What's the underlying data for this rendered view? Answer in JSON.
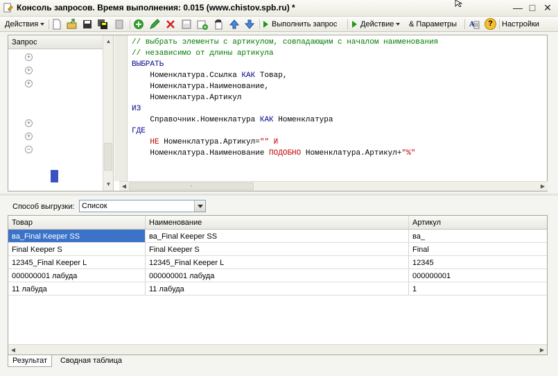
{
  "window": {
    "title": "Консоль запросов. Время выполнения: 0.015 (www.chistov.spb.ru) *",
    "minimize": "—",
    "maximize": "□",
    "close": "✕"
  },
  "toolbar": {
    "actions_label": "Действия",
    "execute_label": "Выполнить запрос",
    "action_label": "Действие",
    "params_label": "Параметры",
    "params_prefix": "&",
    "settings_label": "Настройки",
    "help_glyph": "?",
    "icons": [
      "new-icon",
      "open-icon",
      "save-icon",
      "save-as-icon",
      "copy-icon",
      "add-icon",
      "edit-icon",
      "delete-icon",
      "copy-row-icon",
      "add-param-icon",
      "refresh-icon",
      "up-icon",
      "down-icon",
      "query-builder-icon",
      "help-icon"
    ]
  },
  "tree": {
    "header": "Запрос",
    "expanders": [
      "+",
      "+",
      "+",
      "+",
      "+",
      "−"
    ]
  },
  "query": {
    "lines": [
      [
        {
          "t": "// выбрать элементы с артикулом, совпадающим с началом наименования",
          "c": "c"
        }
      ],
      [
        {
          "t": "// независимо от длины артикула",
          "c": "c"
        }
      ],
      [
        {
          "t": "ВЫБРАТЬ",
          "c": "k"
        }
      ],
      [
        {
          "t": "    Номенклатура.Ссылка ",
          "c": ""
        },
        {
          "t": "КАК",
          "c": "k"
        },
        {
          "t": " Товар,",
          "c": ""
        }
      ],
      [
        {
          "t": "    Номенклатура.Наименование,",
          "c": ""
        }
      ],
      [
        {
          "t": "    Номенклатура.Артикул",
          "c": ""
        }
      ],
      [
        {
          "t": "ИЗ",
          "c": "k"
        }
      ],
      [
        {
          "t": "    Справочник.Номенклатура ",
          "c": ""
        },
        {
          "t": "КАК",
          "c": "k"
        },
        {
          "t": " Номенклатура",
          "c": ""
        }
      ],
      [
        {
          "t": "ГДЕ",
          "c": "k"
        }
      ],
      [
        {
          "t": "    ",
          "c": ""
        },
        {
          "t": "НЕ",
          "c": "r"
        },
        {
          "t": " Номенклатура.Артикул=",
          "c": ""
        },
        {
          "t": "\"\"",
          "c": "r"
        },
        {
          "t": " И",
          "c": "r"
        }
      ],
      [
        {
          "t": "    Номенклатура.Наименование ",
          "c": ""
        },
        {
          "t": "ПОДОБНО",
          "c": "r"
        },
        {
          "t": " Номенклатура.Артикул+",
          "c": ""
        },
        {
          "t": "\"%\"",
          "c": "r"
        }
      ]
    ]
  },
  "export": {
    "label": "Способ выгрузки:",
    "value": "Список"
  },
  "results": {
    "columns": [
      "Товар",
      "Наименование",
      "Артикул"
    ],
    "rows": [
      [
        "ва_Final Keeper SS",
        "ва_Final Keeper SS",
        "ва_"
      ],
      [
        "Final Keeper S",
        "Final Keeper S",
        "Final"
      ],
      [
        "12345_Final Keeper L",
        "12345_Final Keeper L",
        "12345"
      ],
      [
        "000000001 лабуда",
        "000000001 лабуда",
        "000000001"
      ],
      [
        "11 лабуда",
        "11 лабуда",
        "1"
      ]
    ]
  },
  "tabs": [
    "Результат",
    "Сводная таблица"
  ],
  "colors": {
    "selection": "#3a73c8",
    "comment": "#007a00",
    "keyword": "#00008b",
    "operator": "#c00000"
  }
}
